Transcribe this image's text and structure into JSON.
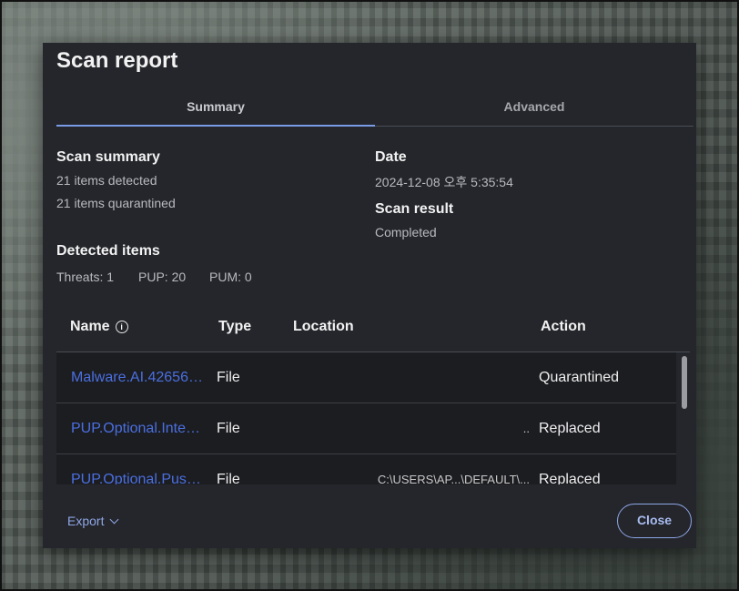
{
  "dialog": {
    "title": "Scan report"
  },
  "tabs": [
    {
      "label": "Summary",
      "active": true
    },
    {
      "label": "Advanced",
      "active": false
    }
  ],
  "summary": {
    "scan_summary_heading": "Scan summary",
    "items_detected": "21 items detected",
    "items_quarantined": "21 items quarantined",
    "date_heading": "Date",
    "date_value": "2024-12-08 오후 5:35:54",
    "scan_result_heading": "Scan result",
    "scan_result_value": "Completed",
    "detected_heading": "Detected items",
    "threats": "Threats: 1",
    "pup": "PUP: 20",
    "pum": "PUM: 0"
  },
  "table": {
    "columns": [
      "Name",
      "Type",
      "Location",
      "Action"
    ],
    "info_icon": "info-icon",
    "rows": [
      {
        "name": "Malware.AI.42656…",
        "type": "File",
        "location": "",
        "action": "Quarantined"
      },
      {
        "name": "PUP.Optional.Inter…",
        "type": "File",
        "location": "..",
        "action": "Replaced"
      },
      {
        "name": "PUP.Optional.Push…",
        "type": "File",
        "location": "C:\\USERS\\AP...\\DEFAULT\\...",
        "action": "Replaced"
      }
    ]
  },
  "footer": {
    "export_label": "Export",
    "close_label": "Close"
  },
  "colors": {
    "accent": "#7a9be6",
    "link": "#4a6fe0",
    "dialog_bg": "#24262b"
  }
}
